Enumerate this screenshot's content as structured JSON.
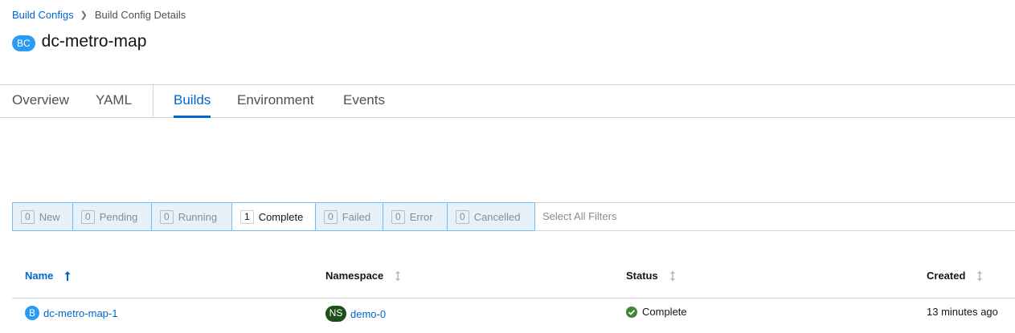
{
  "breadcrumb": {
    "parent": "Build Configs",
    "current": "Build Config Details"
  },
  "header": {
    "badge": "BC",
    "title": "dc-metro-map"
  },
  "tabs": [
    {
      "label": "Overview",
      "active": false
    },
    {
      "label": "YAML",
      "active": false
    },
    {
      "label": "Builds",
      "active": true
    },
    {
      "label": "Environment",
      "active": false
    },
    {
      "label": "Events",
      "active": false
    }
  ],
  "filters": [
    {
      "count": "0",
      "label": "New",
      "active": false
    },
    {
      "count": "0",
      "label": "Pending",
      "active": false
    },
    {
      "count": "0",
      "label": "Running",
      "active": false
    },
    {
      "count": "1",
      "label": "Complete",
      "active": true
    },
    {
      "count": "0",
      "label": "Failed",
      "active": false
    },
    {
      "count": "0",
      "label": "Error",
      "active": false
    },
    {
      "count": "0",
      "label": "Cancelled",
      "active": false
    }
  ],
  "select_all": "Select All Filters",
  "table": {
    "columns": [
      {
        "label": "Name",
        "sort": "ascending"
      },
      {
        "label": "Namespace",
        "sort": "none"
      },
      {
        "label": "Status",
        "sort": "none"
      },
      {
        "label": "Created",
        "sort": "none"
      }
    ],
    "rows": [
      {
        "name_badge": "B",
        "name": "dc-metro-map-1",
        "namespace_badge": "NS",
        "namespace": "demo-0",
        "status": "Complete",
        "created": "13 minutes ago"
      }
    ]
  },
  "colors": {
    "link": "#0066cc",
    "success": "#3e8635",
    "filter_border": "#73bcf7",
    "namespace_badge": "#1e4f18",
    "resource_badge": "#2b9af3"
  }
}
